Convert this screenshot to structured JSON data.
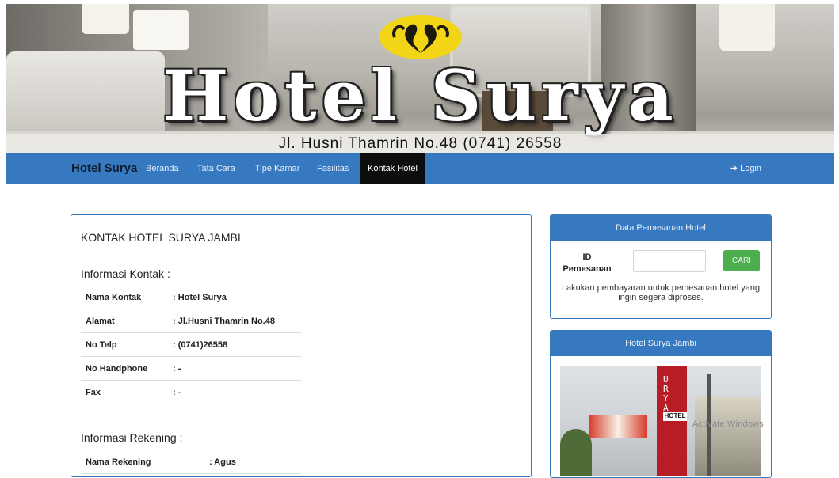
{
  "banner": {
    "title": "Hotel Surya",
    "address": "Jl. Husni Thamrin No.48 (0741) 26558"
  },
  "navbar": {
    "brand": "Hotel Surya",
    "items": [
      {
        "label": "Beranda"
      },
      {
        "label": "Tata Cara"
      },
      {
        "label": "Tipe Kamar"
      },
      {
        "label": "Fasilitas"
      },
      {
        "label": "Kontak Hotel",
        "active": true
      }
    ],
    "login": "Login"
  },
  "contact": {
    "heading": "KONTAK HOTEL SURYA JAMBI",
    "info_title": "Informasi Kontak :",
    "info_rows": [
      {
        "key": "Nama Kontak",
        "value": ": Hotel Surya"
      },
      {
        "key": "Alamat",
        "value": ": Jl.Husni Thamrin No.48"
      },
      {
        "key": "No Telp",
        "value": ": (0741)26558"
      },
      {
        "key": "No Handphone",
        "value": ": -"
      },
      {
        "key": "Fax",
        "value": ": -"
      }
    ],
    "rekening_title": "Informasi Rekening :",
    "rekening_rows": [
      {
        "key": "Nama Rekening",
        "value": ": Agus"
      }
    ]
  },
  "booking_panel": {
    "title": "Data Pemesanan Hotel",
    "id_label": "ID Pemesanan",
    "id_value": "",
    "search_button": "CARI",
    "note": "Lakukan pembayaran untuk pemesanan hotel yang ingin segera diproses."
  },
  "hotel_panel": {
    "title": "Hotel Surya Jambi",
    "photo_sign_letters": "U R Y A",
    "photo_hotel_tag": "HOTEL"
  },
  "watermark": "Activate Windows",
  "colors": {
    "navbar": "#3779c0",
    "active_nav": "#0d0d0d",
    "button_green": "#4cae4c"
  }
}
